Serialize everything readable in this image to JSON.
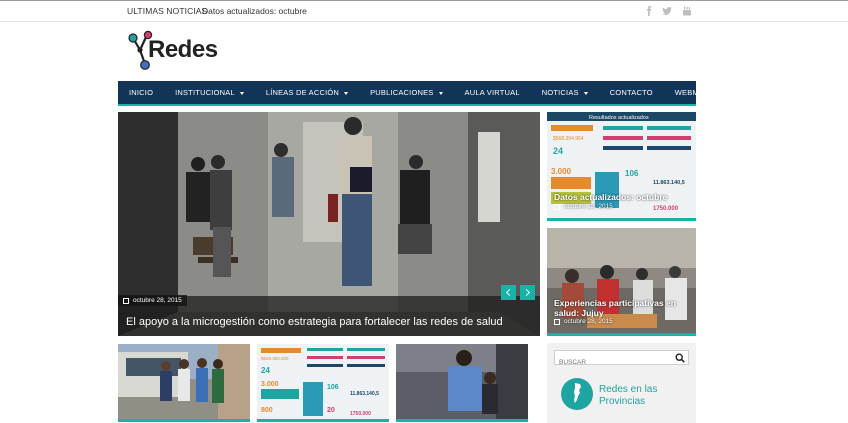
{
  "topbar": {
    "ticker_label": "ULTIMAS NOTICIAS",
    "ticker_text": "Datos actualizados: octubre",
    "social_icons": [
      "facebook-icon",
      "twitter-icon",
      "youtube-icon"
    ]
  },
  "logo": {
    "text": "Redes"
  },
  "nav": {
    "items": [
      {
        "label": "INICIO",
        "dropdown": false
      },
      {
        "label": "INSTITUCIONAL",
        "dropdown": true
      },
      {
        "label": "LÍNEAS DE ACCIÓN",
        "dropdown": true
      },
      {
        "label": "PUBLICACIONES",
        "dropdown": true
      },
      {
        "label": "AULA VIRTUAL",
        "dropdown": false
      },
      {
        "label": "NOTICIAS",
        "dropdown": true
      },
      {
        "label": "CONTACTO",
        "dropdown": false
      },
      {
        "label": "WEBMAIL",
        "dropdown": false
      }
    ]
  },
  "hero": {
    "date": "octubre 28, 2015",
    "title": "El apoyo a la microgestión como estrategia para fortalecer las redes de salud"
  },
  "side_cards": [
    {
      "title": "Datos actualizados: octubre",
      "date": "octubre 28, 2015",
      "image_heading": "Resultados actualizados",
      "infographic": {
        "n1": "$568.394.964",
        "n2": "24",
        "n3": "3.000",
        "n4": "106",
        "n5": "11.863.140,5",
        "n6": "1750.000"
      }
    },
    {
      "title": "Experiencias participativas en salud: Jujuy",
      "date": "octubre 28, 2015"
    }
  ],
  "thumb_infographic": {
    "n1": "$639.300.000",
    "n2": "24",
    "n3": "3.000",
    "n4": "106",
    "n5": "11.863.140,5",
    "n6": "20",
    "n7": "1750.000",
    "n8": "800"
  },
  "sidebar": {
    "search_placeholder": "BUSCAR",
    "provinces_line1": "Redes en las",
    "provinces_line2": "Provincias"
  },
  "colors": {
    "nav_bg": "#113458",
    "accent": "#17b3a6",
    "brand_text": "#1ea5a1"
  }
}
